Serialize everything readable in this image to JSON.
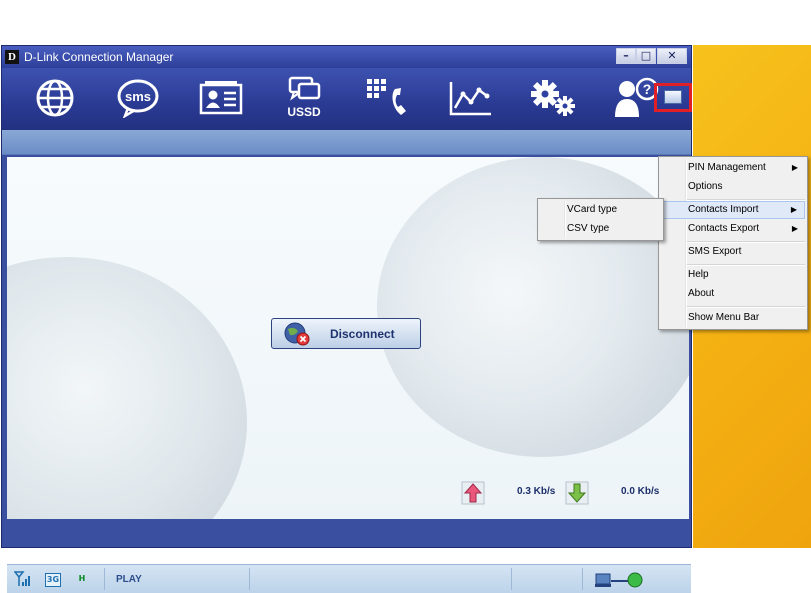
{
  "window": {
    "title": "D-Link Connection Manager",
    "logo_letter": "D",
    "controls": {
      "minimize": "–",
      "maximize": "□",
      "close": "✕"
    }
  },
  "toolbar": {
    "items": [
      {
        "icon": "globe-icon"
      },
      {
        "icon": "sms-icon",
        "text": "sms"
      },
      {
        "icon": "contacts-card-icon"
      },
      {
        "icon": "ussd-icon",
        "text": "USSD"
      },
      {
        "icon": "phone-dialpad-icon"
      },
      {
        "icon": "statistics-chart-icon"
      },
      {
        "icon": "settings-gears-icon"
      },
      {
        "icon": "help-person-icon"
      }
    ]
  },
  "main": {
    "disconnect_label": "Disconnect",
    "upload_speed": "0.3 Kb/s",
    "download_speed": "0.0 Kb/s"
  },
  "status": {
    "network_badge": "3G",
    "h_badge": "H",
    "operator": "PLAY"
  },
  "context_menu": {
    "items": [
      {
        "label": "PIN Management",
        "submenu": true
      },
      {
        "label": "Options"
      },
      {
        "label": "Contacts Import",
        "submenu": true,
        "highlighted": true
      },
      {
        "label": "Contacts Export",
        "submenu": true
      },
      {
        "label": "SMS Export"
      },
      {
        "label": "Help"
      },
      {
        "label": "About"
      },
      {
        "label": "Show Menu Bar"
      }
    ],
    "submenu_arrow": "▶"
  },
  "submenu": {
    "items": [
      {
        "label": "VCard type"
      },
      {
        "label": "CSV type"
      }
    ]
  },
  "colors": {
    "toolbar": "#2a3a93",
    "accent_red": "#e01f26",
    "background_yellow": "#f4b012"
  }
}
